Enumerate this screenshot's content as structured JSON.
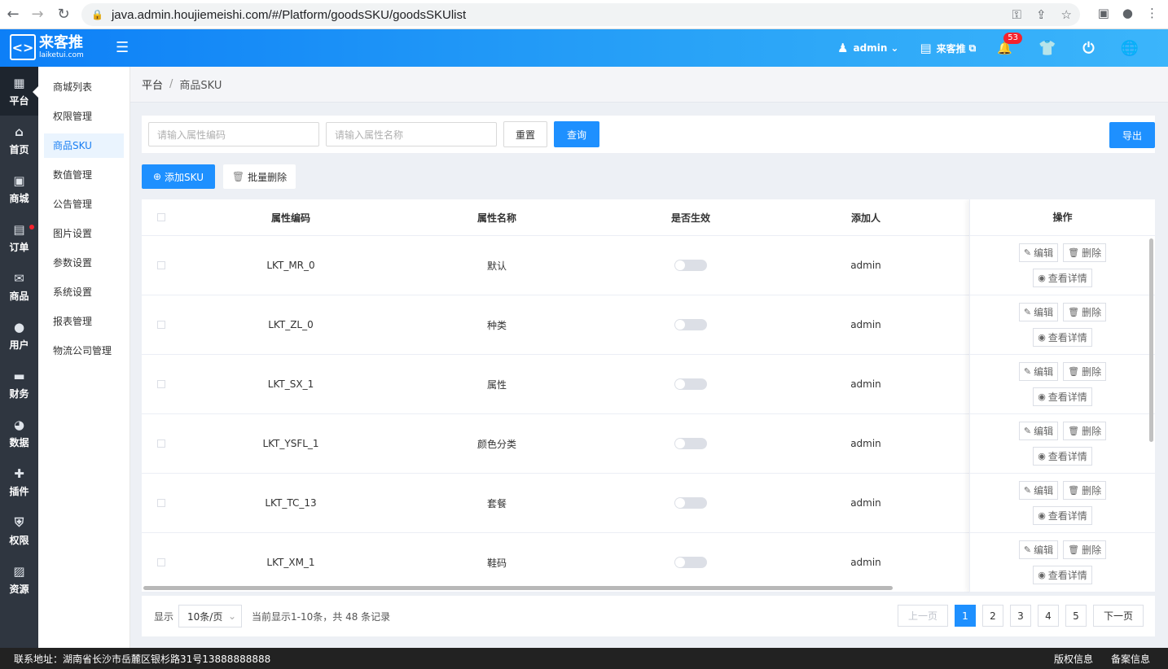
{
  "browser": {
    "url": "java.admin.houjiemeishi.com/#/Platform/goodsSKU/goodsSKUlist"
  },
  "header": {
    "logo_cn": "来客推",
    "logo_en": "laiketui.com",
    "user": "admin",
    "store": "来客推",
    "notif_count": "53"
  },
  "leftnav": [
    {
      "label": "平台",
      "icon": "calendar-icon"
    },
    {
      "label": "首页",
      "icon": "home-icon"
    },
    {
      "label": "商城",
      "icon": "store-icon"
    },
    {
      "label": "订单",
      "icon": "clipboard-icon"
    },
    {
      "label": "商品",
      "icon": "inbox-icon"
    },
    {
      "label": "用户",
      "icon": "user-icon"
    },
    {
      "label": "财务",
      "icon": "wallet-icon"
    },
    {
      "label": "数据",
      "icon": "pie-chart-icon"
    },
    {
      "label": "插件",
      "icon": "puzzle-icon"
    },
    {
      "label": "权限",
      "icon": "shield-icon"
    },
    {
      "label": "资源",
      "icon": "image-icon"
    }
  ],
  "subnav": [
    "商城列表",
    "权限管理",
    "商品SKU",
    "数值管理",
    "公告管理",
    "图片设置",
    "参数设置",
    "系统设置",
    "报表管理",
    "物流公司管理"
  ],
  "breadcrumb": {
    "root": "平台",
    "current": "商品SKU"
  },
  "filter": {
    "code_placeholder": "请输入属性编码",
    "name_placeholder": "请输入属性名称",
    "reset": "重置",
    "query": "查询",
    "export": "导出"
  },
  "actions": {
    "add": "添加SKU",
    "batch_delete": "批量删除"
  },
  "table": {
    "headers": {
      "code": "属性编码",
      "name": "属性名称",
      "active": "是否生效",
      "adder": "添加人",
      "ops": "操作"
    },
    "rows": [
      {
        "code": "LKT_MR_0",
        "name": "默认",
        "adder": "admin",
        "active": false
      },
      {
        "code": "LKT_ZL_0",
        "name": "种类",
        "adder": "admin",
        "active": false
      },
      {
        "code": "LKT_SX_1",
        "name": "属性",
        "adder": "admin",
        "active": false
      },
      {
        "code": "LKT_YSFL_1",
        "name": "颜色分类",
        "adder": "admin",
        "active": false
      },
      {
        "code": "LKT_TC_13",
        "name": "套餐",
        "adder": "admin",
        "active": false
      },
      {
        "code": "LKT_XM_1",
        "name": "鞋码",
        "adder": "admin",
        "active": false
      }
    ],
    "op_labels": {
      "edit": "编辑",
      "delete": "删除",
      "detail": "查看详情"
    }
  },
  "pager": {
    "show_label": "显示",
    "page_size": "10条/页",
    "summary": "当前显示1-10条，共 48 条记录",
    "prev": "上一页",
    "next": "下一页",
    "pages": [
      "1",
      "2",
      "3",
      "4",
      "5"
    ],
    "current": "1"
  },
  "footer": {
    "address": "联系地址：湖南省长沙市岳麓区银杉路31号13888888888",
    "copyright": "版权信息",
    "icp": "备案信息"
  },
  "colors": {
    "primary": "#1e90ff",
    "header_start": "#0d7ff7",
    "header_end": "#3bb5fb",
    "sidebar": "#2f3640"
  }
}
